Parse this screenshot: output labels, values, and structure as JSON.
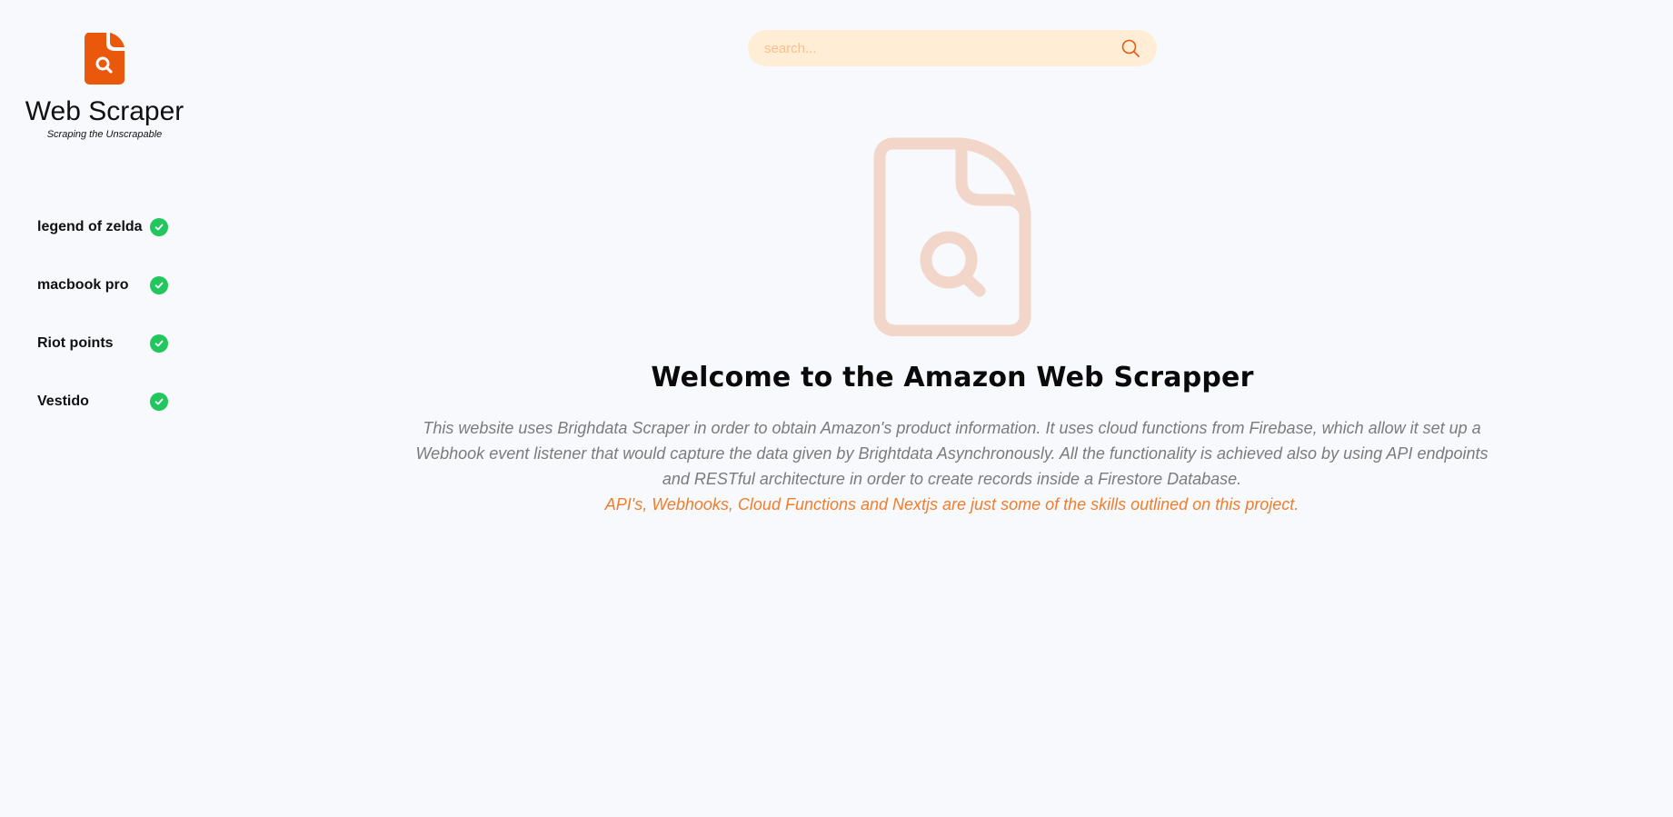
{
  "brand": {
    "title": "Web Scraper",
    "tagline": "Scraping the Unscrapable",
    "accent_color": "#ea580c",
    "logo_icon": "document-search-icon"
  },
  "searches": [
    {
      "label": "legend of zelda",
      "status": "completed",
      "icon": "check-circle-icon"
    },
    {
      "label": "macbook pro",
      "status": "completed",
      "icon": "check-circle-icon"
    },
    {
      "label": "Riot points",
      "status": "completed",
      "icon": "check-circle-icon"
    },
    {
      "label": "Vestido",
      "status": "completed",
      "icon": "check-circle-icon"
    }
  ],
  "status_color": "#22c55e",
  "search": {
    "placeholder": "search...",
    "background": "#ffedd5",
    "icon": "search-icon",
    "icon_color": "#ea580c"
  },
  "hero": {
    "icon": "document-search-icon",
    "icon_color": "#f3d6ca",
    "title": "Welcome to the Amazon Web Scrapper",
    "description": "This website uses Brighdata Scraper in order to obtain Amazon's product information. It uses cloud functions from Firebase, which allow it set up a Webhook event listener that would capture the data given by Brightdata Asynchronously. All the functionality is achieved also by using API endpoints and RESTful architecture in order to create records inside a Firestore Database.",
    "highlight": "API's, Webhooks, Cloud Functions and Nextjs are just some of the skills outlined on this project.",
    "highlight_color": "#f07d2c"
  }
}
